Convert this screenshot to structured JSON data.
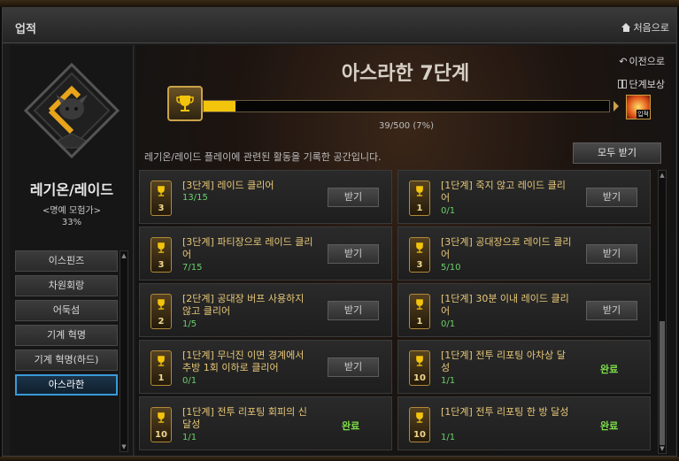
{
  "window": {
    "title": "업적",
    "home_label": "처음으로"
  },
  "sidebar": {
    "category_name": "레기온/레이드",
    "category_title": "<명예 모험가>",
    "category_percent": "33%",
    "items": [
      {
        "label": "이스핀즈",
        "active": false
      },
      {
        "label": "차원회랑",
        "active": false
      },
      {
        "label": "어둑섬",
        "active": false
      },
      {
        "label": "기계 혁명",
        "active": false
      },
      {
        "label": "기계 혁명(하드)",
        "active": false
      },
      {
        "label": "아스라한",
        "active": true
      }
    ]
  },
  "main": {
    "achievement_title": "아스라한 7단계",
    "prev_label": "이전으로",
    "step_reward_label": "단계보상",
    "reward_item_label": "입적",
    "progress": {
      "current": 39,
      "total": 500,
      "text": "39/500 (7%)"
    },
    "description": "레기온/레이드 플레이에 관련된 활동을 기록한 공간입니다.",
    "claim_all_label": "모두 받기",
    "claim_label": "받기",
    "done_label": "완료",
    "cards": [
      {
        "level": "3",
        "title": "[3단계] 레이드 클리어",
        "progress": "13/15",
        "status": "claim"
      },
      {
        "level": "1",
        "title": "[1단계] 죽지 않고 레이드 클리어",
        "progress": "0/1",
        "status": "claim"
      },
      {
        "level": "3",
        "title": "[3단계] 파티장으로 레이드 클리어",
        "progress": "7/15",
        "status": "claim"
      },
      {
        "level": "3",
        "title": "[3단계] 공대장으로 레이드 클리어",
        "progress": "5/10",
        "status": "claim"
      },
      {
        "level": "2",
        "title": "[2단계] 공대장 버프 사용하지 않고 클리어",
        "progress": "1/5",
        "status": "claim"
      },
      {
        "level": "1",
        "title": "[1단계] 30분 이내 레이드 클리어",
        "progress": "0/1",
        "status": "claim"
      },
      {
        "level": "1",
        "title": "[1단계] 무너진 이면 경계에서 추방 1회 이하로 클리어",
        "progress": "0/1",
        "status": "claim"
      },
      {
        "level": "10",
        "title": "[1단계] 전투 리포팅 아차상 달성",
        "progress": "1/1",
        "status": "done"
      },
      {
        "level": "10",
        "title": "[1단계] 전투 리포팅 회피의 신 달성",
        "progress": "1/1",
        "status": "done"
      },
      {
        "level": "10",
        "title": "[1단계] 전투 리포팅 한 방 달성",
        "progress": "1/1",
        "status": "done"
      }
    ]
  },
  "colors": {
    "accent": "#f2c40c",
    "active_tab_border": "#3a9ad8",
    "progress_text": "#6cd06c",
    "done_text": "#7ee04a",
    "card_title": "#e8c878"
  }
}
